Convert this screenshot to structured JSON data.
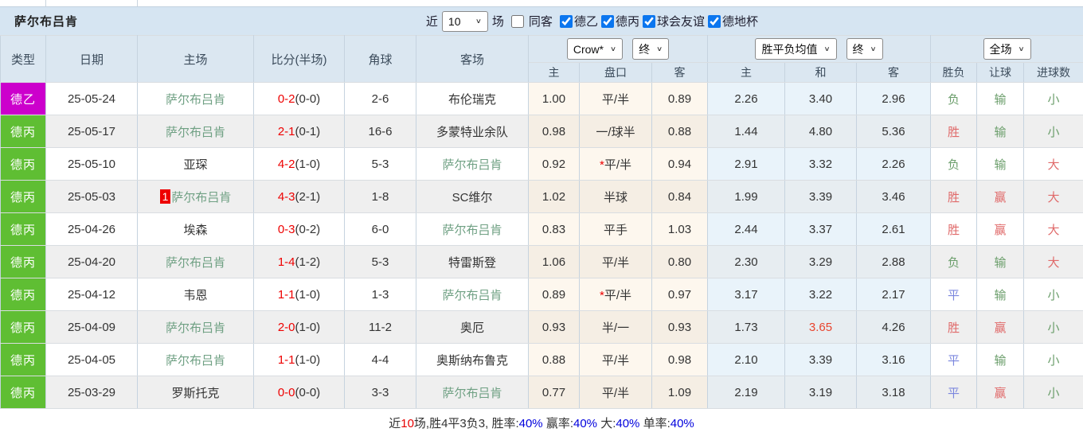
{
  "title": "萨尔布吕肯",
  "filters": {
    "recent_label": "近",
    "recent_value": "10",
    "games_label": "场",
    "same_venue": {
      "label": "同客",
      "checked": false
    },
    "leagues": [
      {
        "label": "德乙",
        "checked": true
      },
      {
        "label": "德丙",
        "checked": true
      },
      {
        "label": "球会友谊",
        "checked": true
      },
      {
        "label": "德地杯",
        "checked": true
      }
    ]
  },
  "header": {
    "main": [
      "类型",
      "日期",
      "主场",
      "比分(半场)",
      "角球",
      "客场"
    ],
    "ah_company_select": "Crow*",
    "ah_time_select": "终",
    "eu_company_select": "胜平负均值",
    "eu_time_select": "终",
    "result_scope_select": "全场",
    "sub": [
      "主",
      "盘口",
      "客",
      "主",
      "和",
      "客",
      "胜负",
      "让球",
      "进球数"
    ]
  },
  "colors": {
    "text_dark": "#333333",
    "num_red": "#e60000",
    "num_blue": "#0000dd",
    "score_red": "#ee0000",
    "odds_red": "#e8442e",
    "team_highlight": "#6fa083",
    "badge_red": "#ee0000",
    "win_red": "#e06a6a",
    "lose_green": "#6b9e6b",
    "draw_blue": "#7b87de",
    "league_de2": "#cc00cc",
    "league_de3": "#5fbe33",
    "checkbox_blue": "#0b76ef"
  },
  "rows": [
    {
      "league": "德乙",
      "league_color": "#cc00cc",
      "date": "25-05-24",
      "home": {
        "name": "萨尔布吕肯",
        "highlight": true,
        "badge": null
      },
      "score": {
        "ft": "0-2",
        "ht": "(0-0)"
      },
      "corner": "2-6",
      "away": {
        "name": "布伦瑞克",
        "highlight": false
      },
      "ah": {
        "home": "1.00",
        "line": "平/半",
        "star": false,
        "away": "0.89"
      },
      "eu": {
        "home": "2.26",
        "draw": "3.40",
        "away": "2.96",
        "draw_red": false
      },
      "result": {
        "wdl": {
          "t": "负",
          "c": "lose_green"
        },
        "handicap": {
          "t": "输",
          "c": "lose_green"
        },
        "goals": {
          "t": "小",
          "c": "lose_green"
        }
      }
    },
    {
      "league": "德丙",
      "league_color": "#5fbe33",
      "date": "25-05-17",
      "home": {
        "name": "萨尔布吕肯",
        "highlight": true,
        "badge": null
      },
      "score": {
        "ft": "2-1",
        "ht": "(0-1)"
      },
      "corner": "16-6",
      "away": {
        "name": "多蒙特业余队",
        "highlight": false
      },
      "ah": {
        "home": "0.98",
        "line": "一/球半",
        "star": false,
        "away": "0.88"
      },
      "eu": {
        "home": "1.44",
        "draw": "4.80",
        "away": "5.36",
        "draw_red": false
      },
      "result": {
        "wdl": {
          "t": "胜",
          "c": "win_red"
        },
        "handicap": {
          "t": "输",
          "c": "lose_green"
        },
        "goals": {
          "t": "小",
          "c": "lose_green"
        }
      }
    },
    {
      "league": "德丙",
      "league_color": "#5fbe33",
      "date": "25-05-10",
      "home": {
        "name": "亚琛",
        "highlight": false,
        "badge": null
      },
      "score": {
        "ft": "4-2",
        "ht": "(1-0)"
      },
      "corner": "5-3",
      "away": {
        "name": "萨尔布吕肯",
        "highlight": true
      },
      "ah": {
        "home": "0.92",
        "line": "平/半",
        "star": true,
        "away": "0.94"
      },
      "eu": {
        "home": "2.91",
        "draw": "3.32",
        "away": "2.26",
        "draw_red": false
      },
      "result": {
        "wdl": {
          "t": "负",
          "c": "lose_green"
        },
        "handicap": {
          "t": "输",
          "c": "lose_green"
        },
        "goals": {
          "t": "大",
          "c": "win_red"
        }
      }
    },
    {
      "league": "德丙",
      "league_color": "#5fbe33",
      "date": "25-05-03",
      "home": {
        "name": "萨尔布吕肯",
        "highlight": true,
        "badge": "1"
      },
      "score": {
        "ft": "4-3",
        "ht": "(2-1)"
      },
      "corner": "1-8",
      "away": {
        "name": "SC维尔",
        "highlight": false
      },
      "ah": {
        "home": "1.02",
        "line": "半球",
        "star": false,
        "away": "0.84"
      },
      "eu": {
        "home": "1.99",
        "draw": "3.39",
        "away": "3.46",
        "draw_red": false
      },
      "result": {
        "wdl": {
          "t": "胜",
          "c": "win_red"
        },
        "handicap": {
          "t": "赢",
          "c": "win_red"
        },
        "goals": {
          "t": "大",
          "c": "win_red"
        }
      }
    },
    {
      "league": "德丙",
      "league_color": "#5fbe33",
      "date": "25-04-26",
      "home": {
        "name": "埃森",
        "highlight": false,
        "badge": null
      },
      "score": {
        "ft": "0-3",
        "ht": "(0-2)"
      },
      "corner": "6-0",
      "away": {
        "name": "萨尔布吕肯",
        "highlight": true
      },
      "ah": {
        "home": "0.83",
        "line": "平手",
        "star": false,
        "away": "1.03"
      },
      "eu": {
        "home": "2.44",
        "draw": "3.37",
        "away": "2.61",
        "draw_red": false
      },
      "result": {
        "wdl": {
          "t": "胜",
          "c": "win_red"
        },
        "handicap": {
          "t": "赢",
          "c": "win_red"
        },
        "goals": {
          "t": "大",
          "c": "win_red"
        }
      }
    },
    {
      "league": "德丙",
      "league_color": "#5fbe33",
      "date": "25-04-20",
      "home": {
        "name": "萨尔布吕肯",
        "highlight": true,
        "badge": null
      },
      "score": {
        "ft": "1-4",
        "ht": "(1-2)"
      },
      "corner": "5-3",
      "away": {
        "name": "特雷斯登",
        "highlight": false
      },
      "ah": {
        "home": "1.06",
        "line": "平/半",
        "star": false,
        "away": "0.80"
      },
      "eu": {
        "home": "2.30",
        "draw": "3.29",
        "away": "2.88",
        "draw_red": false
      },
      "result": {
        "wdl": {
          "t": "负",
          "c": "lose_green"
        },
        "handicap": {
          "t": "输",
          "c": "lose_green"
        },
        "goals": {
          "t": "大",
          "c": "win_red"
        }
      }
    },
    {
      "league": "德丙",
      "league_color": "#5fbe33",
      "date": "25-04-12",
      "home": {
        "name": "韦恩",
        "highlight": false,
        "badge": null
      },
      "score": {
        "ft": "1-1",
        "ht": "(1-0)"
      },
      "corner": "1-3",
      "away": {
        "name": "萨尔布吕肯",
        "highlight": true
      },
      "ah": {
        "home": "0.89",
        "line": "平/半",
        "star": true,
        "away": "0.97"
      },
      "eu": {
        "home": "3.17",
        "draw": "3.22",
        "away": "2.17",
        "draw_red": false
      },
      "result": {
        "wdl": {
          "t": "平",
          "c": "draw_blue"
        },
        "handicap": {
          "t": "输",
          "c": "lose_green"
        },
        "goals": {
          "t": "小",
          "c": "lose_green"
        }
      }
    },
    {
      "league": "德丙",
      "league_color": "#5fbe33",
      "date": "25-04-09",
      "home": {
        "name": "萨尔布吕肯",
        "highlight": true,
        "badge": null
      },
      "score": {
        "ft": "2-0",
        "ht": "(1-0)"
      },
      "corner": "11-2",
      "away": {
        "name": "奥厄",
        "highlight": false
      },
      "ah": {
        "home": "0.93",
        "line": "半/一",
        "star": false,
        "away": "0.93"
      },
      "eu": {
        "home": "1.73",
        "draw": "3.65",
        "away": "4.26",
        "draw_red": true
      },
      "result": {
        "wdl": {
          "t": "胜",
          "c": "win_red"
        },
        "handicap": {
          "t": "赢",
          "c": "win_red"
        },
        "goals": {
          "t": "小",
          "c": "lose_green"
        }
      }
    },
    {
      "league": "德丙",
      "league_color": "#5fbe33",
      "date": "25-04-05",
      "home": {
        "name": "萨尔布吕肯",
        "highlight": true,
        "badge": null
      },
      "score": {
        "ft": "1-1",
        "ht": "(1-0)"
      },
      "corner": "4-4",
      "away": {
        "name": "奥斯纳布鲁克",
        "highlight": false
      },
      "ah": {
        "home": "0.88",
        "line": "平/半",
        "star": false,
        "away": "0.98"
      },
      "eu": {
        "home": "2.10",
        "draw": "3.39",
        "away": "3.16",
        "draw_red": false
      },
      "result": {
        "wdl": {
          "t": "平",
          "c": "draw_blue"
        },
        "handicap": {
          "t": "输",
          "c": "lose_green"
        },
        "goals": {
          "t": "小",
          "c": "lose_green"
        }
      }
    },
    {
      "league": "德丙",
      "league_color": "#5fbe33",
      "date": "25-03-29",
      "home": {
        "name": "罗斯托克",
        "highlight": false,
        "badge": null
      },
      "score": {
        "ft": "0-0",
        "ht": "(0-0)"
      },
      "corner": "3-3",
      "away": {
        "name": "萨尔布吕肯",
        "highlight": true
      },
      "ah": {
        "home": "0.77",
        "line": "平/半",
        "star": false,
        "away": "1.09"
      },
      "eu": {
        "home": "2.19",
        "draw": "3.19",
        "away": "3.18",
        "draw_red": false
      },
      "result": {
        "wdl": {
          "t": "平",
          "c": "draw_blue"
        },
        "handicap": {
          "t": "赢",
          "c": "win_red"
        },
        "goals": {
          "t": "小",
          "c": "lose_green"
        }
      }
    }
  ],
  "summary": {
    "segments": [
      {
        "t": "近",
        "c": "text_dark"
      },
      {
        "t": "10",
        "c": "num_red"
      },
      {
        "t": "场,胜4平3负3, ",
        "c": "text_dark"
      },
      {
        "t": "胜率:",
        "c": "text_dark"
      },
      {
        "t": "40%",
        "c": "num_blue"
      },
      {
        "t": " 赢率:",
        "c": "text_dark"
      },
      {
        "t": "40%",
        "c": "num_blue"
      },
      {
        "t": " 大:",
        "c": "text_dark"
      },
      {
        "t": "40%",
        "c": "num_blue"
      },
      {
        "t": " 单率:",
        "c": "text_dark"
      },
      {
        "t": "40%",
        "c": "num_blue"
      }
    ]
  }
}
